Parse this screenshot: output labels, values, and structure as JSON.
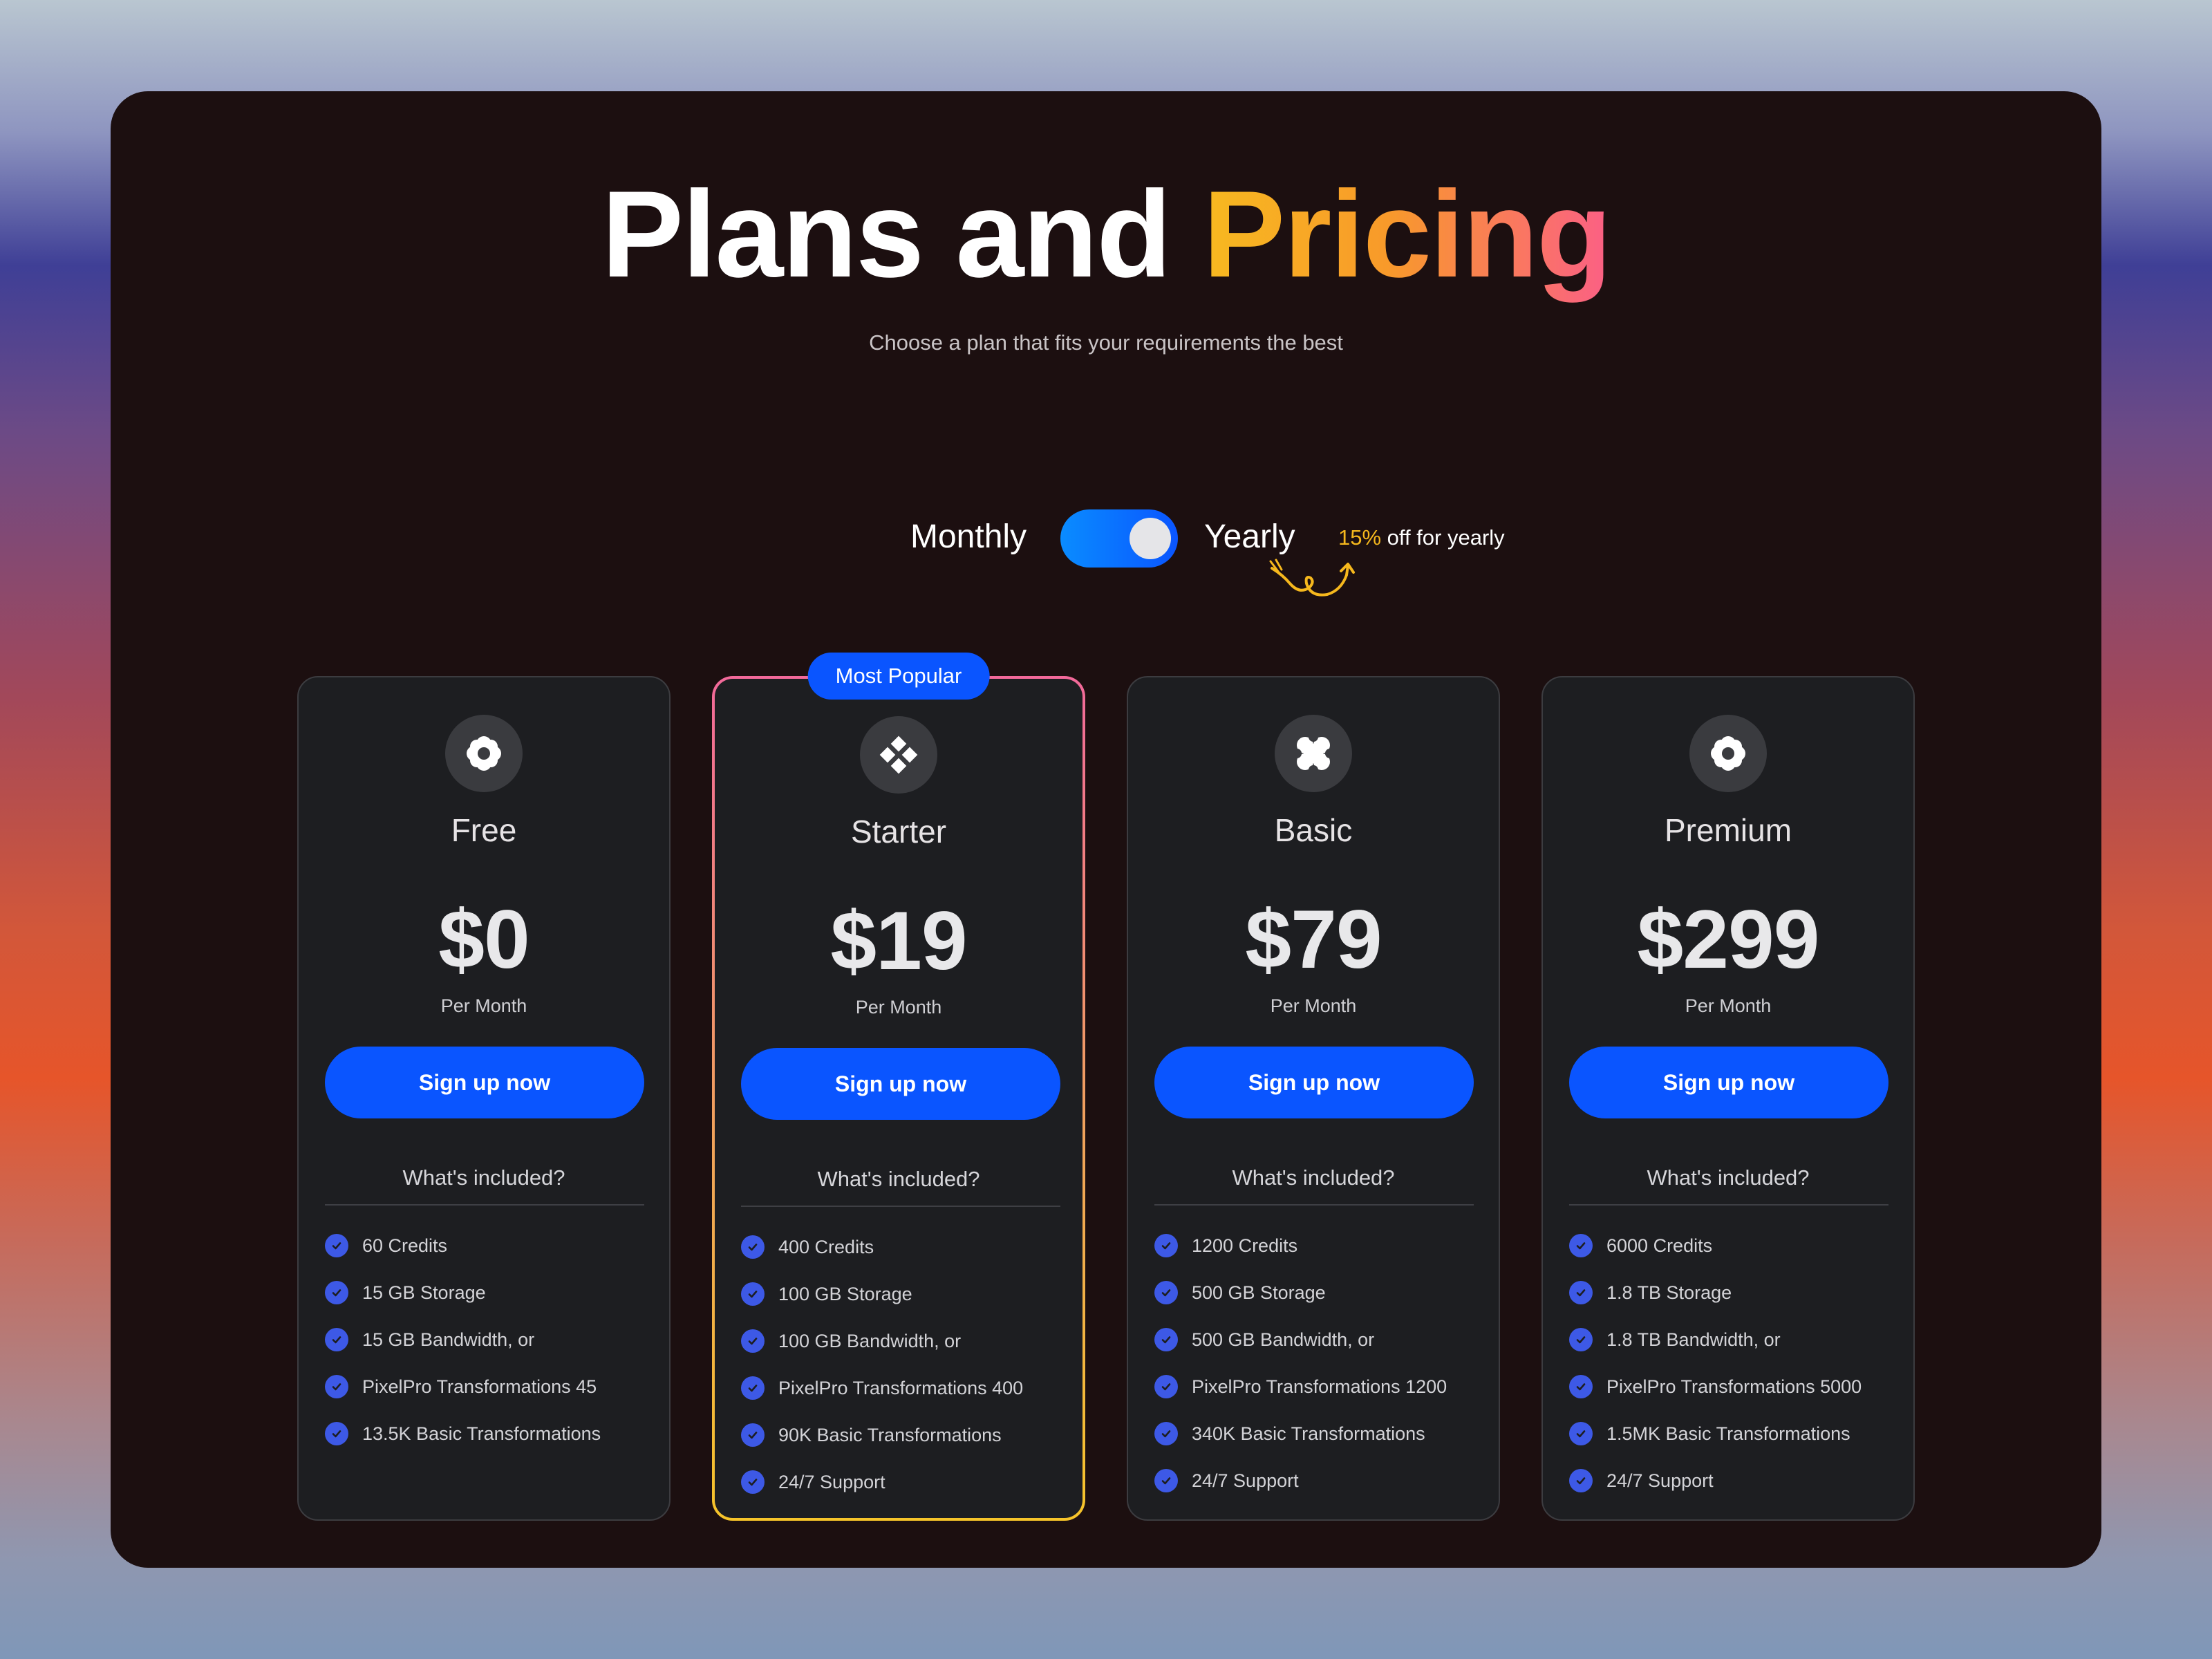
{
  "header": {
    "title_main": "Plans and ",
    "title_accent": "Pricing",
    "subtitle": "Choose a plan that fits your requirements the best"
  },
  "billing": {
    "monthly_label": "Monthly",
    "yearly_label": "Yearly",
    "toggle_state": "yearly",
    "discount_pct": "15%",
    "discount_text": " off for yearly"
  },
  "colors": {
    "primary": "#0a55ff",
    "check": "#3d59e6",
    "discount": "#f6b81d",
    "featured_border_top": "#f2699a",
    "featured_border_bottom": "#f6c42a"
  },
  "plans": [
    {
      "name": "Free",
      "icon": "flower-icon",
      "price": "$0",
      "period": "Per Month",
      "cta": "Sign up now",
      "included_label": "What's included?",
      "features": [
        "60 Credits",
        "15 GB Storage",
        "15 GB Bandwidth, or",
        "PixelPro Transformations 45",
        "13.5K Basic Transformations"
      ]
    },
    {
      "name": "Starter",
      "icon": "diamond-grid-icon",
      "badge": "Most Popular",
      "price": "$19",
      "period": "Per Month",
      "cta": "Sign up now",
      "included_label": "What's included?",
      "features": [
        "400 Credits",
        "100 GB Storage",
        "100 GB Bandwidth, or",
        "PixelPro Transformations 400",
        "90K Basic Transformations",
        "24/7 Support"
      ]
    },
    {
      "name": "Basic",
      "icon": "clover-icon",
      "price": "$79",
      "period": "Per Month",
      "cta": "Sign up now",
      "included_label": "What's included?",
      "features": [
        "1200 Credits",
        "500 GB Storage",
        "500 GB Bandwidth, or",
        "PixelPro Transformations 1200",
        "340K Basic Transformations",
        "24/7 Support"
      ]
    },
    {
      "name": "Premium",
      "icon": "flower-icon",
      "price": "$299",
      "period": "Per Month",
      "cta": "Sign up now",
      "included_label": "What's included?",
      "features": [
        "6000 Credits",
        "1.8 TB Storage",
        "1.8 TB Bandwidth, or",
        "PixelPro Transformations 5000",
        "1.5MK Basic Transformations",
        "24/7 Support"
      ]
    }
  ]
}
